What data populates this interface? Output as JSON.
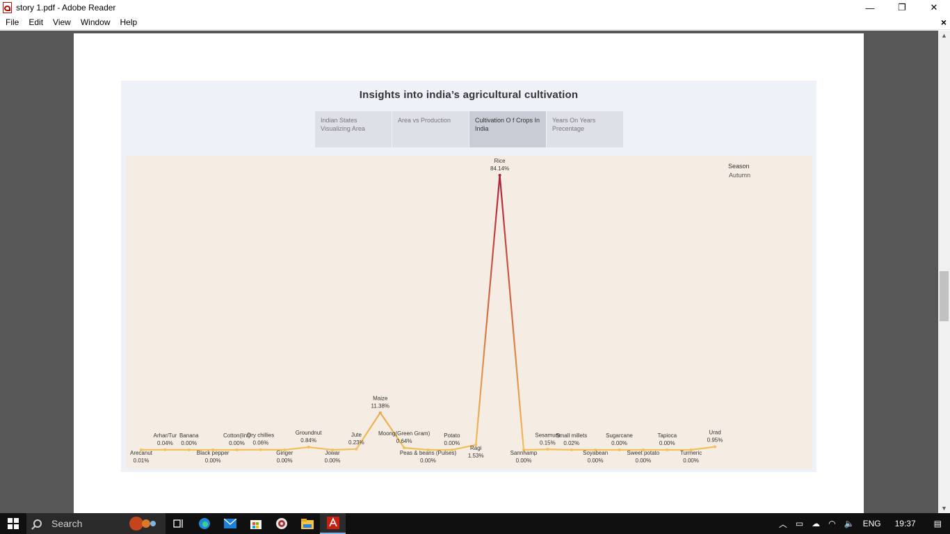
{
  "window": {
    "title": "story 1.pdf - Adobe Reader",
    "minimize": "—",
    "restore": "❐",
    "close": "✕"
  },
  "menu": {
    "items": [
      "File",
      "Edit",
      "View",
      "Window",
      "Help"
    ],
    "close_doc": "×"
  },
  "dashboard": {
    "title": "Insights into india’s agricultural cultivation",
    "tabs": [
      {
        "line1": "Indian States",
        "line2": "Visualizing Area"
      },
      {
        "line1": "Area vs Production",
        "line2": ""
      },
      {
        "line1": "Cultivation O f Crops In",
        "line2": "India"
      },
      {
        "line1": "Years On Years",
        "line2": "Precentage"
      }
    ],
    "active_tab": 2,
    "filter": {
      "label": "Season",
      "value": "Autumn"
    }
  },
  "chart_data": {
    "type": "line",
    "title": "",
    "xlabel": "",
    "ylabel": "",
    "categories": [
      "Arecanut",
      "Arhar/Tur",
      "Banana",
      "Black pepper",
      "Cotton(lint)",
      "Dry chillies",
      "Ginger",
      "Groundnut",
      "Jowar",
      "Jute",
      "Maize",
      "Moong(Green Gram)",
      "Peas & beans (Pulses)",
      "Potato",
      "Ragi",
      "Rice",
      "Sannhamp",
      "Sesamum",
      "Small millets",
      "Soyabean",
      "Sugarcane",
      "Sweet potato",
      "Tapioca",
      "Turmeric",
      "Urad"
    ],
    "series": [
      {
        "values": [
          0.01,
          0.04,
          0.0,
          0.0,
          0.0,
          0.06,
          0.0,
          0.84,
          0.0,
          0.23,
          11.38,
          0.64,
          0.0,
          0.0,
          1.53,
          84.14,
          0.0,
          0.15,
          0.02,
          0.0,
          0.0,
          0.0,
          0.0,
          0.0,
          0.95
        ]
      }
    ],
    "value_labels": [
      "0.01%",
      "0.04%",
      "0.00%",
      "0.00%",
      "0.00%",
      "0.06%",
      "0.00%",
      "0.84%",
      "0.00%",
      "0.23%",
      "11.38%",
      "0.64%",
      "0.00%",
      "0.00%",
      "1.53%",
      "84.14%",
      "0.00%",
      "0.15%",
      "0.02%",
      "0.00%",
      "0.00%",
      "0.00%",
      "0.00%",
      "0.00%",
      "0.95%"
    ],
    "label_positions": [
      "below",
      "above",
      "above",
      "below",
      "above",
      "above",
      "below",
      "above",
      "below",
      "above",
      "above",
      "above",
      "below",
      "above",
      "below",
      "above",
      "below",
      "above",
      "above",
      "below",
      "above",
      "below",
      "above",
      "below",
      "above"
    ],
    "color_low": "#f2c057",
    "color_high": "#b0203a",
    "grid": false
  },
  "taskbar": {
    "search_placeholder": "Search",
    "icons": [
      "task-view-icon",
      "edge-icon",
      "mail-icon",
      "store-icon",
      "media-player-icon",
      "file-explorer-icon",
      "acrobat-icon"
    ],
    "tray": {
      "language": "ENG",
      "time": "19:37"
    }
  }
}
